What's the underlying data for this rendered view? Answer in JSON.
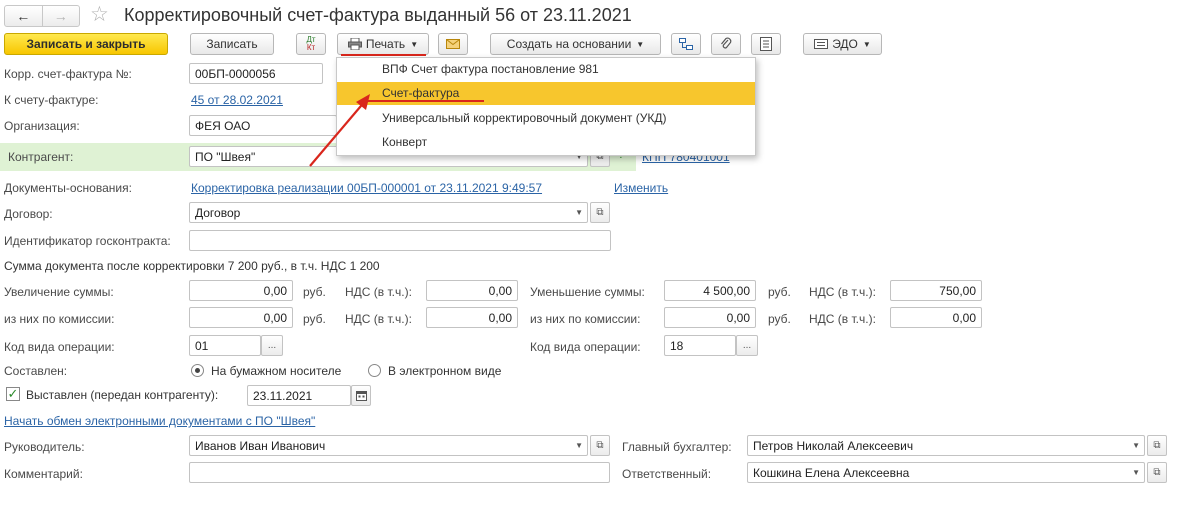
{
  "header": {
    "title": "Корректировочный счет-фактура выданный 56 от 23.11.2021",
    "nav_back": "←",
    "nav_forward": "→",
    "favorite": "☆"
  },
  "toolbar": {
    "save_close": "Записать и закрыть",
    "save": "Записать",
    "dt_kt_top": "Дт",
    "dt_kt_bottom": "Кт",
    "print": "Печать",
    "create_based": "Создать на основании",
    "edo": "ЭДО"
  },
  "print_menu": {
    "items": [
      "ВПФ Счет фактура постановление 981",
      "Счет-фактура",
      "Универсальный корректировочный документ (УКД)",
      "Конверт"
    ],
    "active_index": 1
  },
  "form": {
    "corr_invoice_label": "Корр. счет-фактура №:",
    "corr_invoice_value": "00БП-0000056",
    "to_invoice_label": "К счету-фактуре:",
    "to_invoice_link": "45 от 28.02.2021",
    "organization_label": "Организация:",
    "organization_value": "ФЕЯ ОАО",
    "counterparty_label": "Контрагент:",
    "counterparty_value": "ПО \"Швея\"",
    "kpp_link": "КПП 780401001",
    "base_docs_label": "Документы-основания:",
    "base_docs_link": "Корректировка реализации 00БП-000001 от 23.11.2021 9:49:57",
    "change_link": "Изменить",
    "contract_label": "Договор:",
    "contract_value": "Договор",
    "gov_contract_label": "Идентификатор госконтракта:",
    "gov_contract_value": "",
    "sum_text": "Сумма документа после корректировки 7 200 руб., в т.ч. НДС 1 200",
    "increase_label": "Увеличение суммы:",
    "increase_value": "0,00",
    "rub": "руб.",
    "vat_label": "НДС (в т.ч.):",
    "increase_vat": "0,00",
    "increase_commission_label": "из них по комиссии:",
    "increase_commission_value": "0,00",
    "increase_commission_vat": "0,00",
    "decrease_label": "Уменьшение суммы:",
    "decrease_value": "4 500,00",
    "decrease_vat": "750,00",
    "decrease_commission_label": "из них по комиссии:",
    "decrease_commission_value": "0,00",
    "decrease_commission_vat": "0,00",
    "op_code_label": "Код вида операции:",
    "op_code_value": "01",
    "op_code2_label": "Код вида операции:",
    "op_code2_value": "18",
    "composed_label": "Составлен:",
    "paper_option": "На бумажном носителе",
    "electronic_option": "В электронном виде",
    "issued_label": "Выставлен (передан контрагенту):",
    "issued_date": "23.11.2021",
    "exchange_link": "Начать обмен электронными документами с ПО \"Швея\"",
    "director_label": "Руководитель:",
    "director_value": "Иванов Иван Иванович",
    "accountant_label": "Главный бухгалтер:",
    "accountant_value": "Петров Николай Алексеевич",
    "comment_label": "Комментарий:",
    "comment_value": "",
    "responsible_label": "Ответственный:",
    "responsible_value": "Кошкина Елена Алексеевна",
    "ellipsis": "..."
  },
  "colors": {
    "primary_button": "#f7c600",
    "menu_highlight": "#f7c62d",
    "link": "#2b64a6",
    "counterparty_row": "#dff2d4",
    "annotation_red": "#d9261c"
  }
}
